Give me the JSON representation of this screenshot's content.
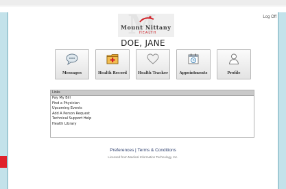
{
  "header": {
    "logout_label": "Log Off",
    "logo": {
      "name": "Mount Nittany",
      "subname": "HEALTH"
    },
    "patient_name": "DOE, JANE"
  },
  "nav_tiles": [
    {
      "label": "Messages",
      "icon": "messages-icon"
    },
    {
      "label": "Health Record",
      "icon": "health-record-icon"
    },
    {
      "label": "Health Tracker",
      "icon": "heart-icon"
    },
    {
      "label": "Appointments",
      "icon": "calendar-icon"
    },
    {
      "label": "Profile",
      "icon": "user-icon"
    }
  ],
  "links": {
    "header": "Links",
    "items": [
      "Pay My Bill",
      "Find a Physician",
      "Upcoming Events",
      "Add A Person Request",
      "Technical Support Help",
      "Health Library"
    ]
  },
  "footer": {
    "preferences_label": "Preferences",
    "separator": "|",
    "terms_label": "Terms & Conditions",
    "licensed_text": "Licensed from Medical Information Technology, Inc."
  },
  "colors": {
    "side_bar": "#c3e2ea",
    "accent_red": "#e0222a",
    "footer_link": "#2e3f6e"
  }
}
